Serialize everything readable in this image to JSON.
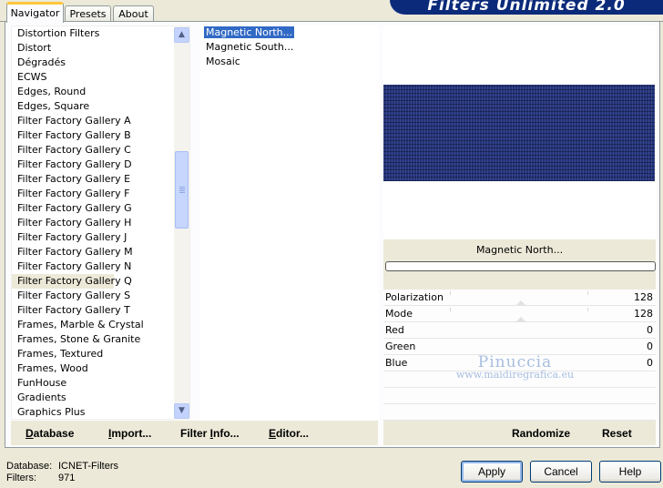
{
  "tabs": [
    {
      "label": "Navigator"
    },
    {
      "label": "Presets"
    },
    {
      "label": "About"
    }
  ],
  "banner": {
    "title": "Filters Unlimited 2.0"
  },
  "categories": [
    "Distortion Filters",
    "Distort",
    "Dégradés",
    "ECWS",
    "Edges, Round",
    "Edges, Square",
    "Filter Factory Gallery A",
    "Filter Factory Gallery B",
    "Filter Factory Gallery C",
    "Filter Factory Gallery D",
    "Filter Factory Gallery E",
    "Filter Factory Gallery F",
    "Filter Factory Gallery G",
    "Filter Factory Gallery H",
    "Filter Factory Gallery J",
    "Filter Factory Gallery M",
    "Filter Factory Gallery N",
    "Filter Factory Gallery Q",
    "Filter Factory Gallery S",
    "Filter Factory Gallery T",
    "Frames, Marble & Crystal",
    "Frames, Stone & Granite",
    "Frames, Textured",
    "Frames, Wood",
    "FunHouse",
    "Gradients",
    "Graphics Plus"
  ],
  "selected_category": "Filter Factory Gallery Q",
  "filters": [
    "Magnetic North...",
    "Magnetic South...",
    "Mosaic"
  ],
  "selected_filter": "Magnetic North...",
  "preview": {
    "filter_name": "Magnetic North...",
    "image_color": "#24337a"
  },
  "params": [
    {
      "label": "Polarization",
      "value": "128"
    },
    {
      "label": "Mode",
      "value": "128"
    },
    {
      "label": "Red",
      "value": "0"
    },
    {
      "label": "Green",
      "value": "0"
    },
    {
      "label": "Blue",
      "value": "0"
    }
  ],
  "watermark": {
    "line1": "Pinuccia",
    "line2": "www.maidiregrafica.eu"
  },
  "bottom_left": {
    "database": {
      "u": "D",
      "rest": "atabase"
    },
    "import": {
      "u": "I",
      "rest": "mport..."
    },
    "filter_info": {
      "pre": "Filter ",
      "u": "I",
      "rest": "nfo..."
    },
    "editor": {
      "u": "E",
      "rest": "ditor..."
    }
  },
  "bottom_right": {
    "randomize": "Randomize",
    "reset": "Reset"
  },
  "status": {
    "database_label": "Database:",
    "database_value": "ICNET-Filters",
    "filters_label": "Filters:",
    "filters_value": "971"
  },
  "dialog": {
    "apply": "Apply",
    "cancel": "Cancel",
    "help": "Help"
  },
  "colors": {
    "accent": "#316ac5",
    "banner": "#0b2a7a",
    "tab_highlight": "#ffc73c"
  }
}
